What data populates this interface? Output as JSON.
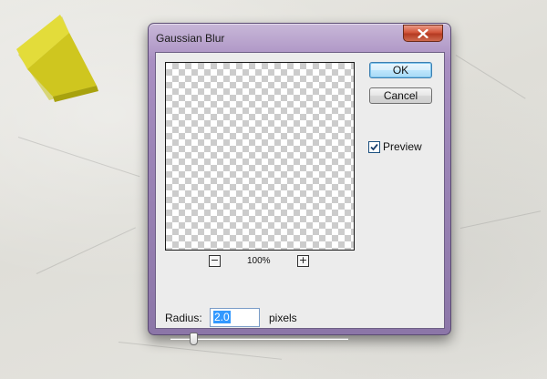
{
  "dialog": {
    "title": "Gaussian Blur",
    "close_icon": "close-x-icon",
    "ok_label": "OK",
    "cancel_label": "Cancel",
    "preview_label": "Preview",
    "preview_checked": true,
    "zoom_out_label": "−",
    "zoom_in_label": "+",
    "zoom_level": "100%",
    "radius_label": "Radius:",
    "radius_value": "2.0",
    "radius_unit": "pixels"
  },
  "colors": {
    "titlebar_accent": "#9c85b7",
    "close_button": "#c94a30",
    "ok_button": "#bee6fd",
    "selection": "#3399ff"
  }
}
